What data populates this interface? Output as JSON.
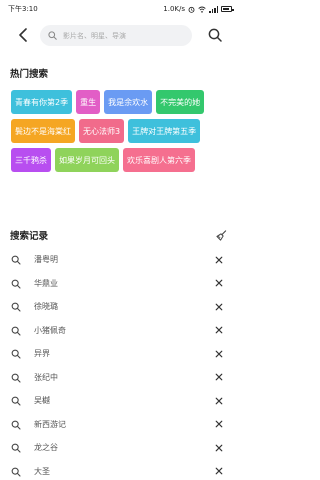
{
  "status_bar": {
    "time": "下午3:10",
    "network_speed": "1.0K/s",
    "battery_level": 0.85
  },
  "search": {
    "placeholder": "影片名、明星、导演"
  },
  "hot_search": {
    "title": "热门搜索",
    "tags": [
      {
        "label": "青春有你第2季",
        "color": "#3ec0dc"
      },
      {
        "label": "重生",
        "color": "#e25ec6"
      },
      {
        "label": "我是余欢水",
        "color": "#6a9bf3"
      },
      {
        "label": "不完美的她",
        "color": "#33c86d"
      },
      {
        "label": "鬓边不是海棠红",
        "color": "#f5a623"
      },
      {
        "label": "无心法师3",
        "color": "#f16b8b"
      },
      {
        "label": "王牌对王牌第五季",
        "color": "#3ec0dc"
      },
      {
        "label": "三千鸦杀",
        "color": "#b84ef0"
      },
      {
        "label": "如果岁月可回头",
        "color": "#8fd35b"
      },
      {
        "label": "欢乐喜剧人第六季",
        "color": "#f56f8f"
      }
    ]
  },
  "history": {
    "title": "搜索记录",
    "items": [
      "潘粤明",
      "华鼎业",
      "徐晓璐",
      "小猪佩奇",
      "异界",
      "张纪中",
      "吴樾",
      "新西游记",
      "龙之谷",
      "大圣"
    ]
  },
  "icons": {
    "back": "chevron-left-icon",
    "search": "search-icon",
    "clear": "broom-icon",
    "history_item": "clock-icon",
    "delete": "close-icon"
  }
}
